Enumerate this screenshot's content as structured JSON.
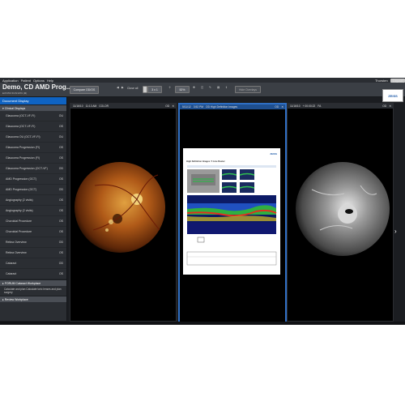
{
  "menu": {
    "items": [
      "Application",
      "Patient",
      "Options",
      "Help"
    ],
    "user": "Thorsten",
    "logout": "Logout"
  },
  "patient": {
    "name": "Demo, CD AMD Prog...",
    "id": "E3725S",
    "dob": "5/15/1976",
    "sex": "(M)"
  },
  "toolbar": {
    "compare_btn": "Compare OD/OS",
    "close_all": "Close all",
    "layout": "3 x 1",
    "zoom": "52%",
    "hide_overlays": "Hide Overlays"
  },
  "sidebar": {
    "title": "Document Display",
    "group1": "Clinical Displays",
    "items": [
      {
        "label": "Glaucoma (OCT-VF-FI)",
        "eye": "OU"
      },
      {
        "label": "Glaucoma (OCT-VF-FI)",
        "eye": "OS"
      },
      {
        "label": "Glaucoma OU (OCT-VF-FI)",
        "eye": "OU"
      },
      {
        "label": "Glaucoma Progression (FI)",
        "eye": "OS"
      },
      {
        "label": "Glaucoma Progression (FI)",
        "eye": "OS"
      },
      {
        "label": "Glaucoma Progression (OCT-VF)",
        "eye": "OD"
      },
      {
        "label": "AMD Progression (OCT)",
        "eye": "OS"
      },
      {
        "label": "AMD Progression (OCT)",
        "eye": "OD"
      },
      {
        "label": "Angiography (2 visits)",
        "eye": "OS"
      },
      {
        "label": "Angiography (2 visits)",
        "eye": "OS"
      },
      {
        "label": "Choroidal Procedure",
        "eye": "OS"
      },
      {
        "label": "Choroidal Procedure",
        "eye": "OS"
      },
      {
        "label": "Retina Overview",
        "eye": "OD"
      },
      {
        "label": "Retina Overview",
        "eye": "OS"
      },
      {
        "label": "Cataract",
        "eye": "OD"
      },
      {
        "label": "Cataract",
        "eye": "OS"
      }
    ],
    "group2": "FORUM Cataract Workplace",
    "group2_desc": "Calculate and plan Calculate toric lenses and plan surgery",
    "group3": "Review Workplace"
  },
  "panels": [
    {
      "date": "11/16/10",
      "time": "11:13 AM",
      "desc": "COLOR",
      "eye": "OD"
    },
    {
      "date": "5/11/12",
      "time": "3:52 PM",
      "desc": "OD High Definition Images",
      "eye": "OD"
    },
    {
      "date": "11/16/10",
      "time": "+ 00:00:22",
      "desc": "FA",
      "eye": "OD"
    }
  ],
  "report": {
    "heading": "High Definition Images: 5 Line Raster",
    "brand": "ZEISS"
  },
  "colors": {
    "accent": "#0f63c2",
    "selected_border": "#2f6fc4",
    "header_bg": "#3b3f45"
  }
}
